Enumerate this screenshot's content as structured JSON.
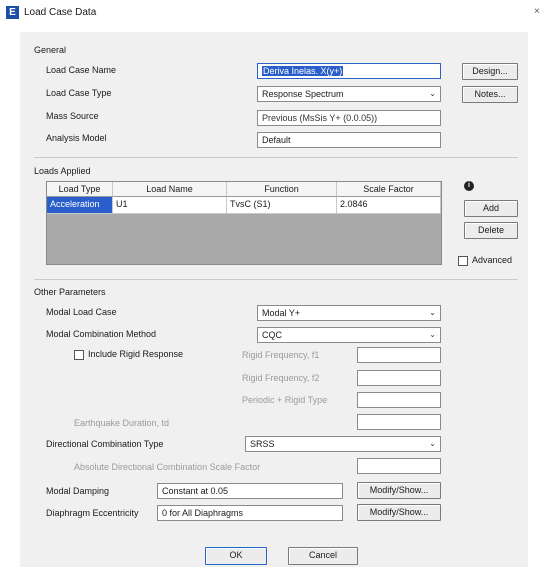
{
  "window": {
    "title": "Load Case Data",
    "app_icon": "E",
    "close_glyph": "×"
  },
  "general": {
    "group_title": "General",
    "load_case_name_label": "Load Case Name",
    "load_case_name_value": "Deriva Inelas. X(y+)",
    "load_case_type_label": "Load Case Type",
    "load_case_type_value": "Response Spectrum",
    "mass_source_label": "Mass Source",
    "mass_source_value": "Previous (MsSis Y+ (0.0.05))",
    "analysis_model_label": "Analysis Model",
    "analysis_model_value": "Default",
    "design_button": "Design...",
    "notes_button": "Notes..."
  },
  "loads_applied": {
    "group_title": "Loads Applied",
    "columns": [
      "Load Type",
      "Load Name",
      "Function",
      "Scale Factor"
    ],
    "rows": [
      {
        "load_type": "Acceleration",
        "load_name": "U1",
        "function": "TvsC (S1)",
        "scale_factor": "2.0846"
      }
    ],
    "add_button": "Add",
    "delete_button": "Delete",
    "advanced_label": "Advanced",
    "advanced_checked": false
  },
  "other_parameters": {
    "group_title": "Other Parameters",
    "modal_load_case_label": "Modal Load Case",
    "modal_load_case_value": "Modal Y+",
    "modal_combination_method_label": "Modal Combination Method",
    "modal_combination_method_value": "CQC",
    "include_rigid_response_label": "Include Rigid Response",
    "include_rigid_response_checked": false,
    "rigid_frequency_f1_label": "Rigid Frequency, f1",
    "rigid_frequency_f2_label": "Rigid Frequency, f2",
    "periodic_rigid_type_label": "Periodic + Rigid Type",
    "earthquake_duration_label": "Earthquake Duration, td",
    "directional_combination_type_label": "Directional Combination Type",
    "directional_combination_type_value": "SRSS",
    "absolute_directional_label": "Absolute Directional Combination Scale Factor",
    "modal_damping_label": "Modal Damping",
    "modal_damping_value": "Constant at 0.05",
    "diaphragm_eccentricity_label": "Diaphragm Eccentricity",
    "diaphragm_eccentricity_value": "0 for All Diaphragms",
    "modify_show_button": "Modify/Show...",
    "modify_show_button_2": "Modify/Show..."
  },
  "footer": {
    "ok_button": "OK",
    "cancel_button": "Cancel"
  },
  "colors": {
    "selection": "#2a5ecb",
    "dialog_bg": "#f0f0f0",
    "table_empty": "#a9a9a9"
  }
}
